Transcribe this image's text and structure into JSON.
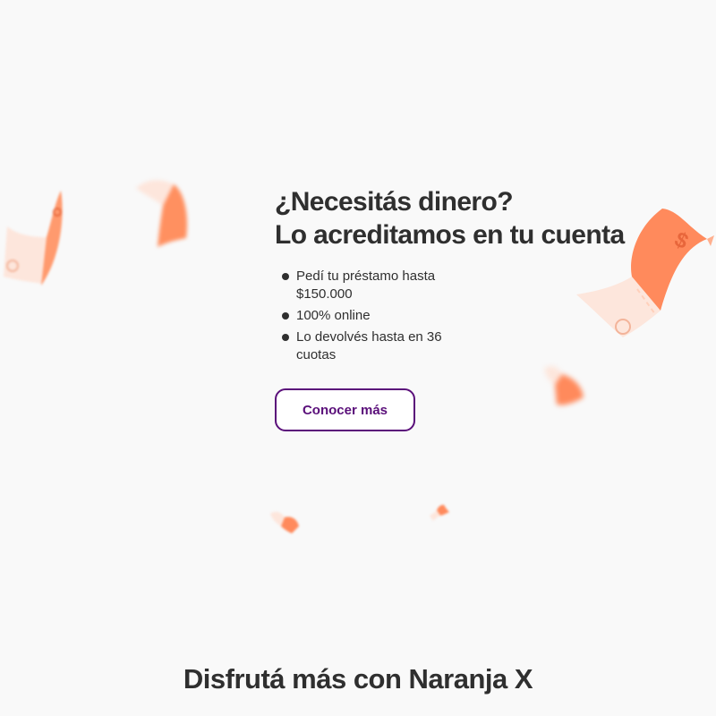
{
  "hero": {
    "title_line1": "¿Necesitás dinero?",
    "title_line2": "Lo acreditamos en tu cuenta",
    "benefits": [
      "Pedí tu préstamo hasta $150.000",
      "100% online",
      "Lo devolvés hasta en 36 cuotas"
    ],
    "cta_label": "Conocer más"
  },
  "section": {
    "heading": "Disfrutá más con Naranja X"
  },
  "decorations": {
    "icon": "flying-money-bill-icon",
    "bill_symbol": "$",
    "colors": {
      "bill_orange": "#ff8a5c",
      "bill_light": "#fde6dc",
      "accent_purple": "#5a0f7a",
      "text_dark": "#2f2f2f",
      "background": "#f9f9f9"
    }
  }
}
